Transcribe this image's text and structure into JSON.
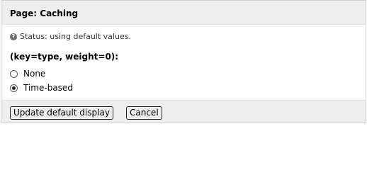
{
  "header": {
    "title": "Page: Caching"
  },
  "status": {
    "icon": "help-icon",
    "text": "Status: using default values."
  },
  "options": {
    "title": "(key=type, weight=0):",
    "choices": [
      {
        "label": "None",
        "selected": false
      },
      {
        "label": "Time-based",
        "selected": true
      }
    ]
  },
  "actions": {
    "update_label": "Update default display",
    "cancel_label": "Cancel"
  }
}
